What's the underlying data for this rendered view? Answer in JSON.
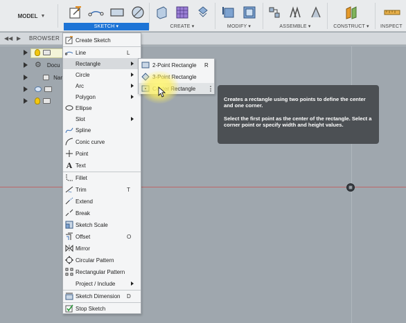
{
  "toolbar": {
    "workspace": "MODEL",
    "groups": [
      "SKETCH",
      "CREATE",
      "MODIFY",
      "ASSEMBLE",
      "CONSTRUCT",
      "INSPECT"
    ],
    "accent": "#1d74d6"
  },
  "browser": {
    "title": "BROWSER",
    "rows": [
      "Docu",
      "Nam"
    ]
  },
  "menu": {
    "items": [
      {
        "label": "Create Sketch",
        "shortcut": "",
        "icon": "create-sketch-icon"
      },
      {
        "label": "Line",
        "shortcut": "L",
        "icon": "line-icon"
      },
      {
        "label": "Rectangle",
        "shortcut": "",
        "icon": "",
        "submenu": true
      },
      {
        "label": "Circle",
        "shortcut": "",
        "icon": "",
        "submenu": true
      },
      {
        "label": "Arc",
        "shortcut": "",
        "icon": "",
        "submenu": true
      },
      {
        "label": "Polygon",
        "shortcut": "",
        "icon": "",
        "submenu": true
      },
      {
        "label": "Ellipse",
        "shortcut": "",
        "icon": "ellipse-icon"
      },
      {
        "label": "Slot",
        "shortcut": "",
        "icon": "",
        "submenu": true
      },
      {
        "label": "Spline",
        "shortcut": "",
        "icon": "spline-icon"
      },
      {
        "label": "Conic curve",
        "shortcut": "",
        "icon": "conic-curve-icon"
      },
      {
        "label": "Point",
        "shortcut": "",
        "icon": "point-icon"
      },
      {
        "label": "Text",
        "shortcut": "",
        "icon": "text-icon"
      },
      {
        "label": "Fillet",
        "shortcut": "",
        "icon": "fillet-icon"
      },
      {
        "label": "Trim",
        "shortcut": "T",
        "icon": "trim-icon"
      },
      {
        "label": "Extend",
        "shortcut": "",
        "icon": "extend-icon"
      },
      {
        "label": "Break",
        "shortcut": "",
        "icon": "break-icon"
      },
      {
        "label": "Sketch Scale",
        "shortcut": "",
        "icon": "sketch-scale-icon"
      },
      {
        "label": "Offset",
        "shortcut": "O",
        "icon": "offset-icon"
      },
      {
        "label": "Mirror",
        "shortcut": "",
        "icon": "mirror-icon"
      },
      {
        "label": "Circular Pattern",
        "shortcut": "",
        "icon": "circular-pattern-icon"
      },
      {
        "label": "Rectangular Pattern",
        "shortcut": "",
        "icon": "rectangular-pattern-icon"
      },
      {
        "label": "Project / Include",
        "shortcut": "",
        "icon": "",
        "submenu": true
      },
      {
        "label": "Sketch Dimension",
        "shortcut": "D",
        "icon": "sketch-dimension-icon"
      },
      {
        "label": "Stop Sketch",
        "shortcut": "",
        "icon": "stop-sketch-icon"
      }
    ]
  },
  "submenu": {
    "items": [
      {
        "label": "2-Point Rectangle",
        "shortcut": "R"
      },
      {
        "label": "3-Point Rectangle",
        "shortcut": ""
      },
      {
        "label": "Center Rectangle",
        "shortcut": ""
      }
    ]
  },
  "tooltip": {
    "line1": "Creates a rectangle using two points to define the center and one corner.",
    "line2": "Select the first point as the center of the rectangle. Select a corner point or specify width and height values."
  }
}
